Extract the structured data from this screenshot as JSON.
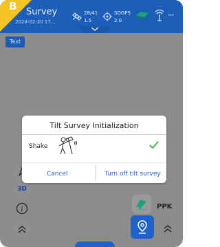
{
  "header": {
    "badge_letter": "B",
    "title": "Survey",
    "subtitle": "2024-02-20 17...",
    "stats": [
      {
        "icon": "satellite-icon",
        "top": "28/41",
        "bottom": "1.5"
      },
      {
        "icon": "gps-target-icon",
        "top": "SDGPS",
        "bottom": "2.0"
      }
    ],
    "more_label": "···"
  },
  "text_chip": "Text",
  "left_tools": {
    "view_3d_label": "3D",
    "info_label": "i"
  },
  "right_tools": {
    "ppk_label": "PPK"
  },
  "dialog": {
    "title": "Tilt Survey Initialization",
    "row_label": "Shake",
    "cancel": "Cancel",
    "turn_off": "Turn off tilt survey"
  },
  "colors": {
    "primary": "#1e64c8",
    "badge": "#f3c423",
    "success": "#4caf50"
  }
}
